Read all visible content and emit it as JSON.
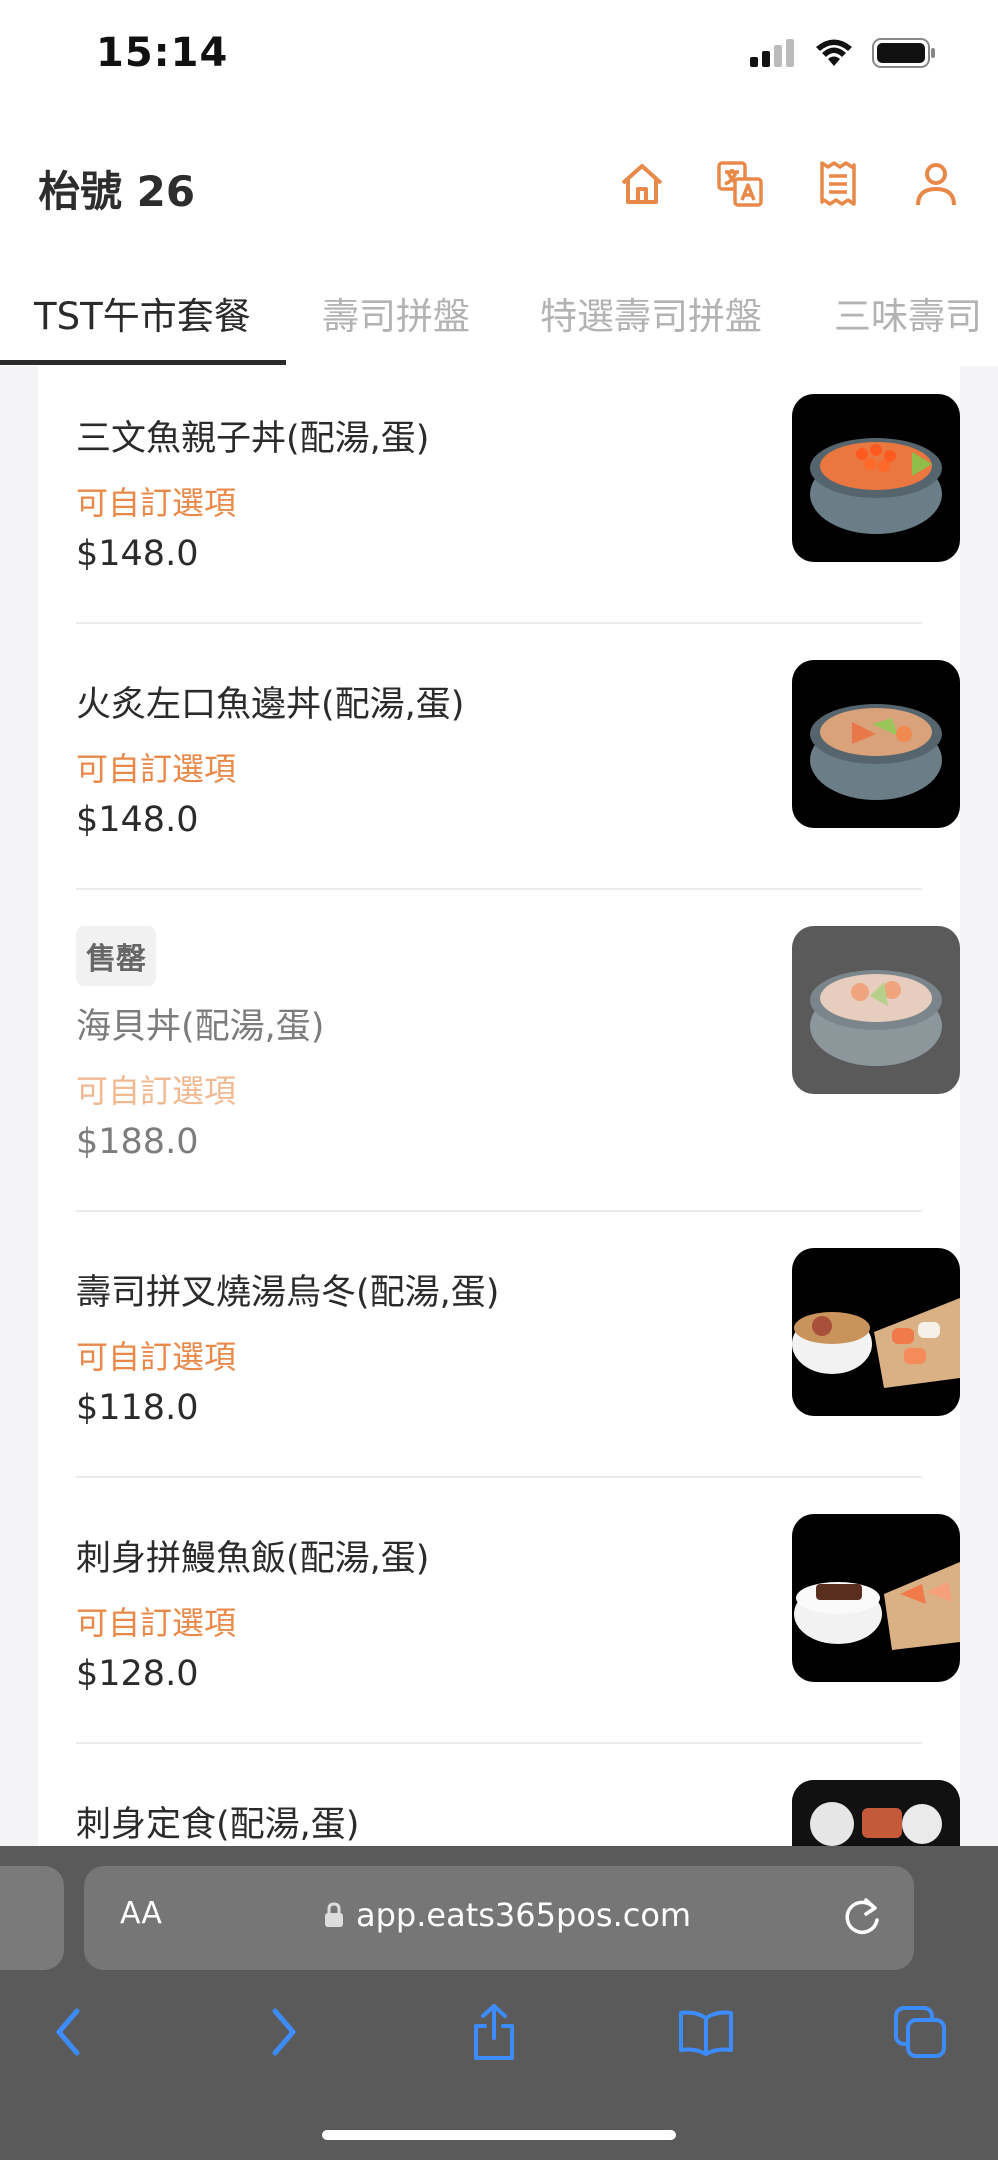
{
  "status": {
    "time": "15:14"
  },
  "header": {
    "title": "枱號 26"
  },
  "tabs": [
    {
      "label": "TST午市套餐"
    },
    {
      "label": "壽司拼盤"
    },
    {
      "label": "特選壽司拼盤"
    },
    {
      "label": "三味壽司"
    }
  ],
  "items": [
    {
      "name": "三文魚親子丼(配湯,蛋)",
      "custom": "可自訂選項",
      "price": "$148.0"
    },
    {
      "name": "火炙左口魚邊丼(配湯,蛋)",
      "custom": "可自訂選項",
      "price": "$148.0"
    },
    {
      "badge": "售罄",
      "name": "海貝丼(配湯,蛋)",
      "custom": "可自訂選項",
      "price": "$188.0"
    },
    {
      "name": "壽司拼叉燒湯烏冬(配湯,蛋)",
      "custom": "可自訂選項",
      "price": "$118.0"
    },
    {
      "name": "刺身拼鰻魚飯(配湯,蛋)",
      "custom": "可自訂選項",
      "price": "$128.0"
    },
    {
      "name": "刺身定食(配湯,蛋)"
    }
  ],
  "browser": {
    "aa_label": "AA",
    "url": "app.eats365pos.com"
  },
  "colors": {
    "accent": "#e8894a",
    "text": "#2b2b2b",
    "muted": "#b3b3b3"
  },
  "icons": [
    "home-icon",
    "translate-icon",
    "receipt-icon",
    "user-icon",
    "lock-icon",
    "reload-icon",
    "back-icon",
    "forward-icon",
    "share-icon",
    "bookmarks-icon",
    "tabs-icon"
  ]
}
